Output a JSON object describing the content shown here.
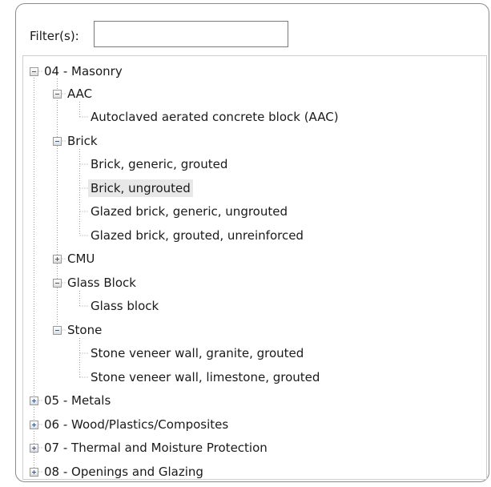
{
  "filter": {
    "label": "Filter(s):",
    "value": "",
    "placeholder": ""
  },
  "tree": {
    "masonry": {
      "label": "04 - Masonry",
      "aac": {
        "label": "AAC",
        "items": [
          "Autoclaved aerated concrete block (AAC)"
        ]
      },
      "brick": {
        "label": "Brick",
        "items": [
          "Brick, generic, grouted",
          "Brick, ungrouted",
          "Glazed brick, generic, ungrouted",
          "Glazed brick, grouted, unreinforced"
        ]
      },
      "cmu": {
        "label": "CMU"
      },
      "glass_block": {
        "label": "Glass Block",
        "items": [
          "Glass block"
        ]
      },
      "stone": {
        "label": "Stone",
        "items": [
          "Stone veneer wall, granite, grouted",
          "Stone veneer wall, limestone, grouted"
        ]
      }
    },
    "metals": {
      "label": "05 - Metals"
    },
    "wood": {
      "label": "06 - Wood/Plastics/Composites"
    },
    "thermal": {
      "label": "07 - Thermal and Moisture Protection"
    },
    "openings": {
      "label": "08 - Openings and Glazing"
    }
  },
  "selected_item": "Brick, ungrouted",
  "colors": {
    "border": "#8a8a8a",
    "selection": "#e8e8e8",
    "connector": "#9a9a9a",
    "toggle_glyph": "#3a5a8a"
  }
}
